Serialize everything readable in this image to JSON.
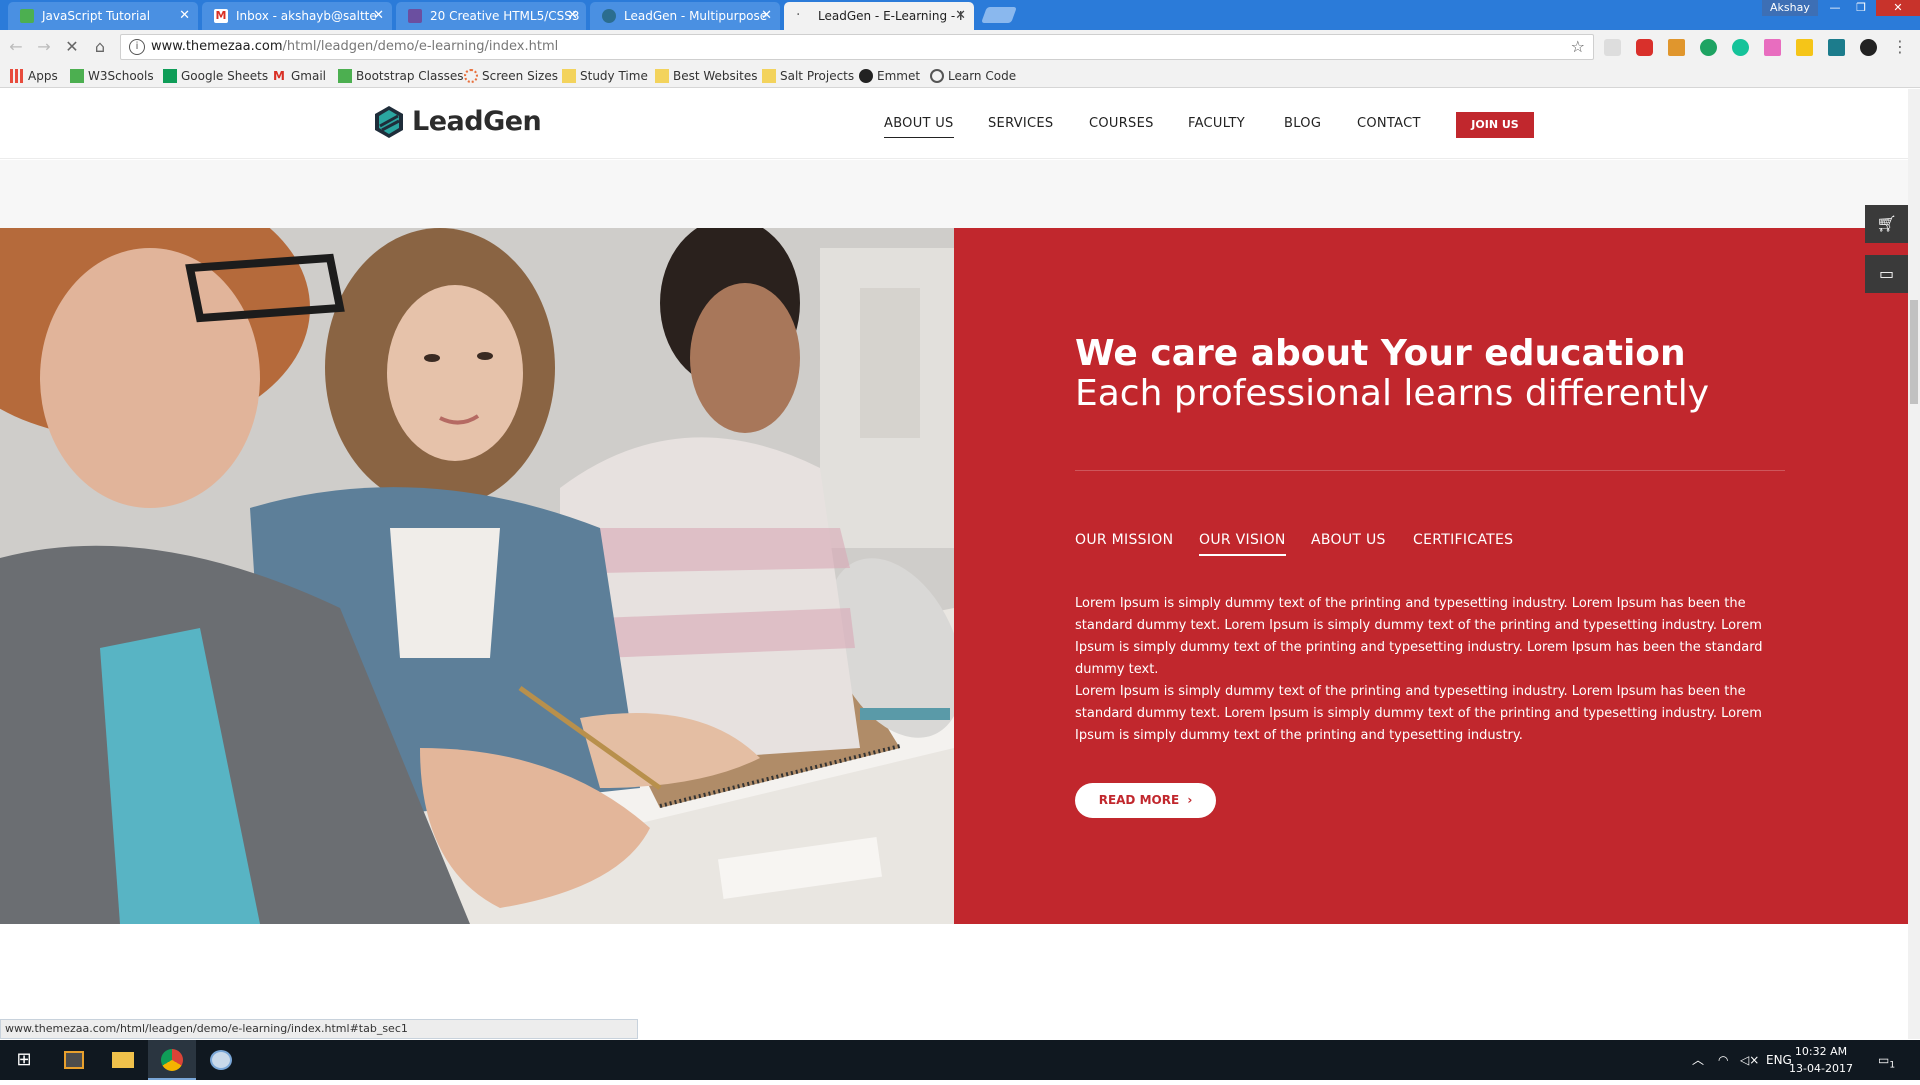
{
  "browser": {
    "tabs": [
      {
        "label": "JavaScript Tutorial",
        "favicon": "w3schools-icon",
        "color": "#4caf50"
      },
      {
        "label": "Inbox - akshayb@saltte",
        "favicon": "gmail-icon",
        "color": "#d93025"
      },
      {
        "label": "20 Creative HTML5/CSS3",
        "favicon": "site-icon",
        "color": "#6b4fa0"
      },
      {
        "label": "LeadGen - Multipurpose",
        "favicon": "globe-icon",
        "color": "#2b6d8f"
      },
      {
        "label": "LeadGen - E-Learning - I",
        "favicon": "loading-icon",
        "color": "#888888"
      }
    ],
    "user": "Akshay",
    "url_host": "www.themezaa.com",
    "url_path": "/html/leadgen/demo/e-learning/index.html",
    "bookmarks": [
      {
        "label": "Apps",
        "icon": "apps-grid-icon",
        "color": "#e84b3c"
      },
      {
        "label": "W3Schools",
        "icon": "w3schools-icon",
        "color": "#4caf50"
      },
      {
        "label": "Google Sheets",
        "icon": "sheets-icon",
        "color": "#0f9d58"
      },
      {
        "label": "Gmail",
        "icon": "gmail-icon",
        "color": "#d93025"
      },
      {
        "label": "Bootstrap Classes",
        "icon": "w3schools-icon",
        "color": "#4caf50"
      },
      {
        "label": "Screen Sizes",
        "icon": "gear-icon",
        "color": "#e8703c"
      },
      {
        "label": "Study Time",
        "icon": "folder-icon",
        "color": "#f3d35c"
      },
      {
        "label": "Best Websites",
        "icon": "folder-icon",
        "color": "#f3d35c"
      },
      {
        "label": "Salt Projects",
        "icon": "folder-icon",
        "color": "#f3d35c"
      },
      {
        "label": "Emmet",
        "icon": "emmet-icon",
        "color": "#222222"
      },
      {
        "label": "Learn Code",
        "icon": "globe-icon",
        "color": "#555555"
      }
    ],
    "status_url": "www.themezaa.com/html/leadgen/demo/e-learning/index.html#tab_sec1"
  },
  "site": {
    "logo": "LeadGen",
    "nav": [
      "ABOUT US",
      "SERVICES",
      "COURSES",
      "FACULTY",
      "BLOG",
      "CONTACT"
    ],
    "nav_active": "ABOUT US",
    "join_label": "JOIN US",
    "accent": "#c1272d"
  },
  "hero": {
    "heading": "We care about Your education",
    "subheading": "Each professional learns differently",
    "tabs": [
      "OUR MISSION",
      "OUR VISION",
      "ABOUT US",
      "CERTIFICATES"
    ],
    "active_tab": "OUR VISION",
    "para1": "Lorem Ipsum is simply dummy text of the printing and typesetting industry. Lorem Ipsum has been the standard dummy text. Lorem Ipsum is simply dummy text of the printing and typesetting industry. Lorem Ipsum is simply dummy text of the printing and typesetting industry. Lorem Ipsum has been the standard dummy text.",
    "para2": "Lorem Ipsum is simply dummy text of the printing and typesetting industry. Lorem Ipsum has been the standard dummy text. Lorem Ipsum is simply dummy text of the printing and typesetting industry. Lorem Ipsum is simply dummy text of the printing and typesetting industry.",
    "read_more": "READ MORE",
    "read_more_icon": "chevron-right-icon"
  },
  "side_buttons": [
    "cart-icon",
    "folder-icon"
  ],
  "taskbar": {
    "language": "ENG",
    "time": "10:32 AM",
    "date": "13-04-2017",
    "notifications": "1"
  }
}
